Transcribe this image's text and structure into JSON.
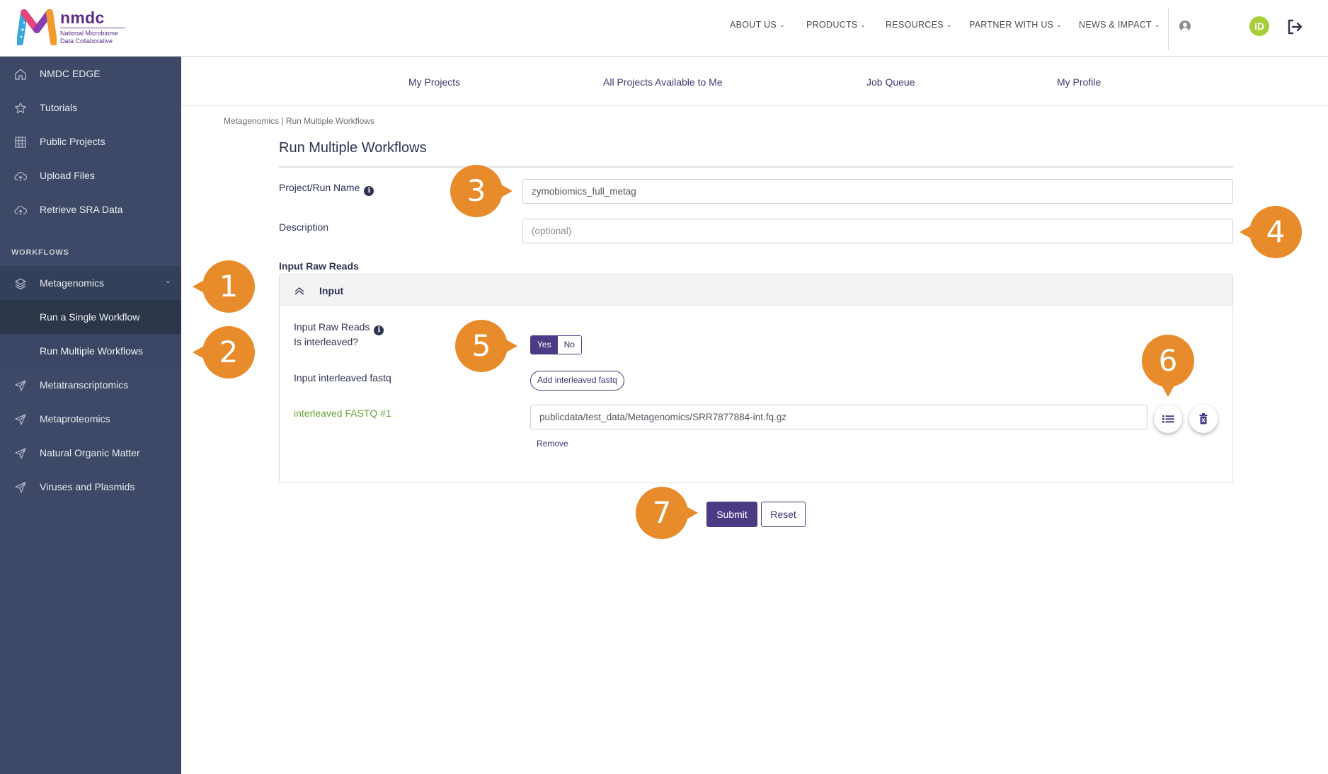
{
  "brand": {
    "name": "nmdc",
    "subtitle_line1": "National Microbiome",
    "subtitle_line2": "Data Collaborative",
    "purple": "#5b2b86",
    "accent": "#4c3a85",
    "callout_orange": "#e88b2a",
    "success_green": "#6aa63a"
  },
  "topnav": {
    "items": [
      {
        "label": "ABOUT US"
      },
      {
        "label": "PRODUCTS"
      },
      {
        "label": "RESOURCES"
      },
      {
        "label": "PARTNER WITH US"
      },
      {
        "label": "NEWS & IMPACT"
      }
    ],
    "orcid_label": "iD",
    "icons": [
      "user-icon",
      "orcid-icon",
      "logout-icon"
    ]
  },
  "sidebar": {
    "items": [
      {
        "label": "NMDC EDGE",
        "icon": "home-icon"
      },
      {
        "label": "Tutorials",
        "icon": "star-icon"
      },
      {
        "label": "Public Projects",
        "icon": "grid-icon"
      },
      {
        "label": "Upload Files",
        "icon": "cloud-upload-icon"
      },
      {
        "label": "Retrieve SRA Data",
        "icon": "cloud-upload-icon"
      }
    ],
    "section_title": "WORKFLOWS",
    "workflows": [
      {
        "label": "Metagenomics",
        "icon": "layers-icon",
        "expanded": true
      },
      {
        "label": "Metatranscriptomics",
        "icon": "send-icon"
      },
      {
        "label": "Metaproteomics",
        "icon": "send-icon"
      },
      {
        "label": "Natural Organic Matter",
        "icon": "send-icon"
      },
      {
        "label": "Viruses and Plasmids",
        "icon": "send-icon"
      }
    ],
    "metagenomics_sub": [
      {
        "label": "Run a Single Workflow"
      },
      {
        "label": "Run Multiple Workflows",
        "selected": true
      }
    ]
  },
  "tabs": [
    {
      "label": "My Projects"
    },
    {
      "label": "All Projects Available to Me"
    },
    {
      "label": "Job Queue"
    },
    {
      "label": "My Profile"
    }
  ],
  "breadcrumb": "Metagenomics | Run Multiple Workflows",
  "page_title": "Run Multiple Workflows",
  "form": {
    "project_name_label": "Project/Run Name",
    "project_name_value": "zymobiomics_full_metag",
    "description_label": "Description",
    "description_placeholder": "(optional)",
    "input_section_label": "Input Raw Reads",
    "panel_title": "Input",
    "raw_reads_label": "Input Raw Reads",
    "interleaved_question": "Is interleaved?",
    "toggle_yes": "Yes",
    "toggle_no": "No",
    "toggle_selected": "Yes",
    "interleaved_fastq_label": "Input interleaved fastq",
    "add_fastq_button": "Add interleaved fastq",
    "fastq_item_label": "interleaved FASTQ #1",
    "fastq_item_value": "publicdata/test_data/Metagenomics/SRR7877884-int.fq.gz",
    "remove_link": "Remove",
    "submit": "Submit",
    "reset": "Reset"
  },
  "callouts": [
    "1",
    "2",
    "3",
    "4",
    "5",
    "6",
    "7"
  ]
}
